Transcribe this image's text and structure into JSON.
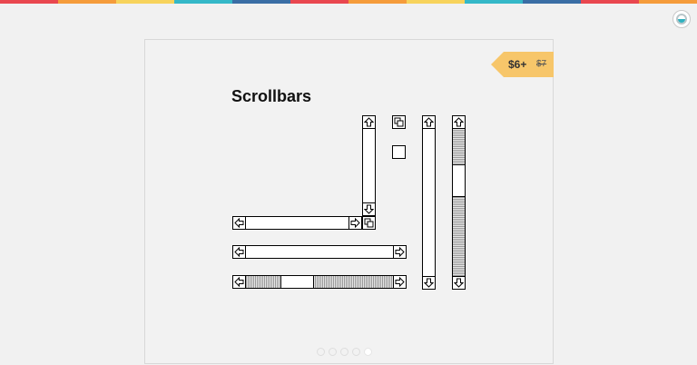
{
  "topbar": {
    "colors": [
      "#e9474f",
      "#f59c3b",
      "#f7d35c",
      "#35b8c8",
      "#3a6ea5",
      "#e9474f",
      "#f59c3b",
      "#f7d35c",
      "#35b8c8",
      "#3a6ea5",
      "#e9474f",
      "#f59c3b"
    ]
  },
  "card": {
    "title": "Scrollbars",
    "price": {
      "current": "$6+",
      "original": "$7"
    }
  },
  "carousel": {
    "slide_count": 5,
    "active_index": 4
  },
  "icons": {
    "up": "arrow-up-icon",
    "down": "arrow-down-icon",
    "left": "arrow-left-icon",
    "right": "arrow-right-icon",
    "resize": "resize-grow-icon"
  }
}
